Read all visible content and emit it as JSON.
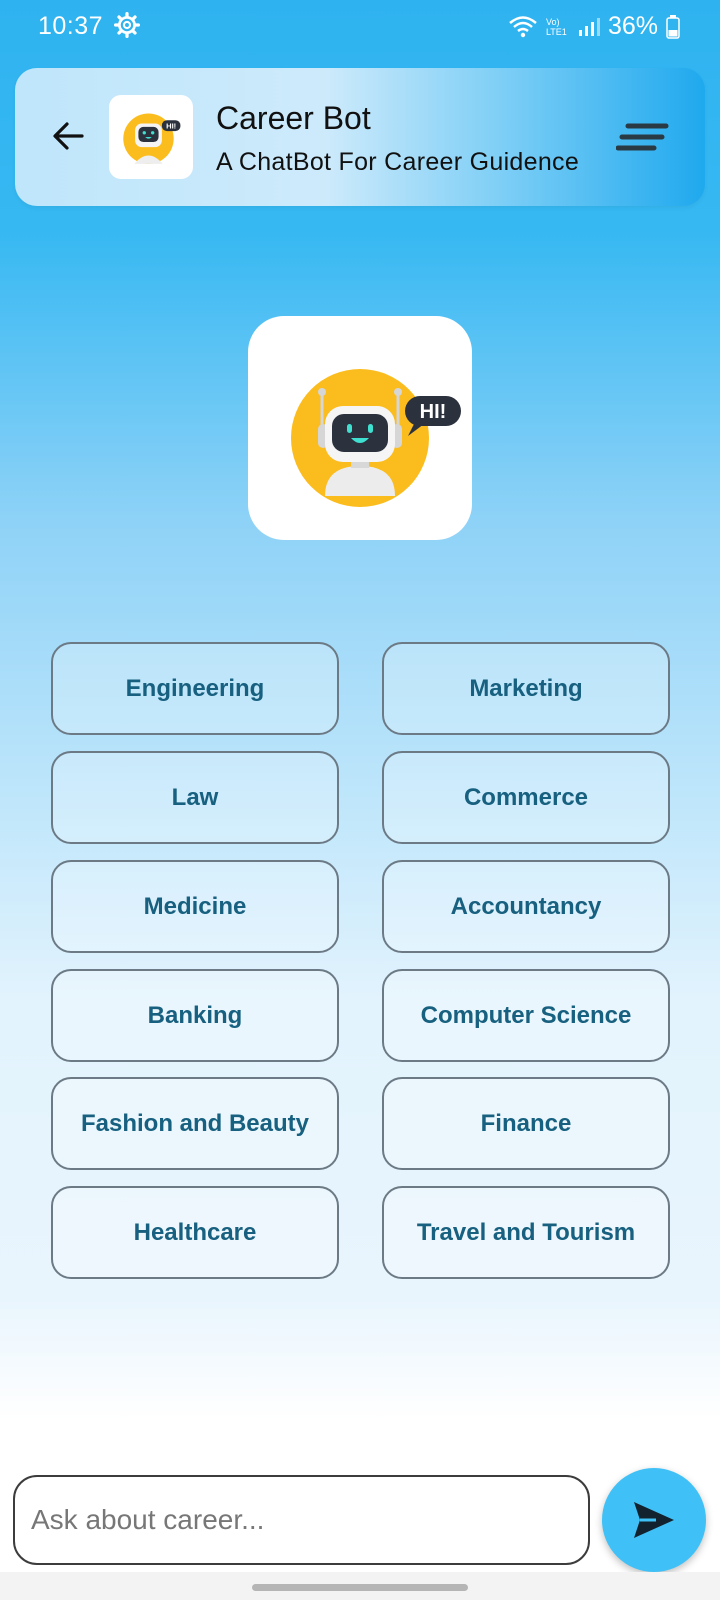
{
  "status_bar": {
    "time": "10:37",
    "network_label": "Vo) LTE1",
    "battery": "36%"
  },
  "header": {
    "title": "Career Bot",
    "subtitle": "A ChatBot For Career Guidence",
    "back_icon": "arrow-left-icon",
    "menu_icon": "menu-lines-icon"
  },
  "bot": {
    "speech_text": "HI!"
  },
  "categories": [
    "Engineering",
    "Marketing",
    "Law",
    "Commerce",
    "Medicine",
    "Accountancy",
    "Banking",
    "Computer Science",
    "Fashion and Beauty",
    "Finance",
    "Healthcare",
    "Travel and Tourism"
  ],
  "composer": {
    "placeholder": "Ask about career...",
    "value": "",
    "send_icon": "send-icon"
  },
  "colors": {
    "accent": "#3fc1f7",
    "chip_text": "#17607f",
    "bot_yellow": "#fbbc1d"
  }
}
